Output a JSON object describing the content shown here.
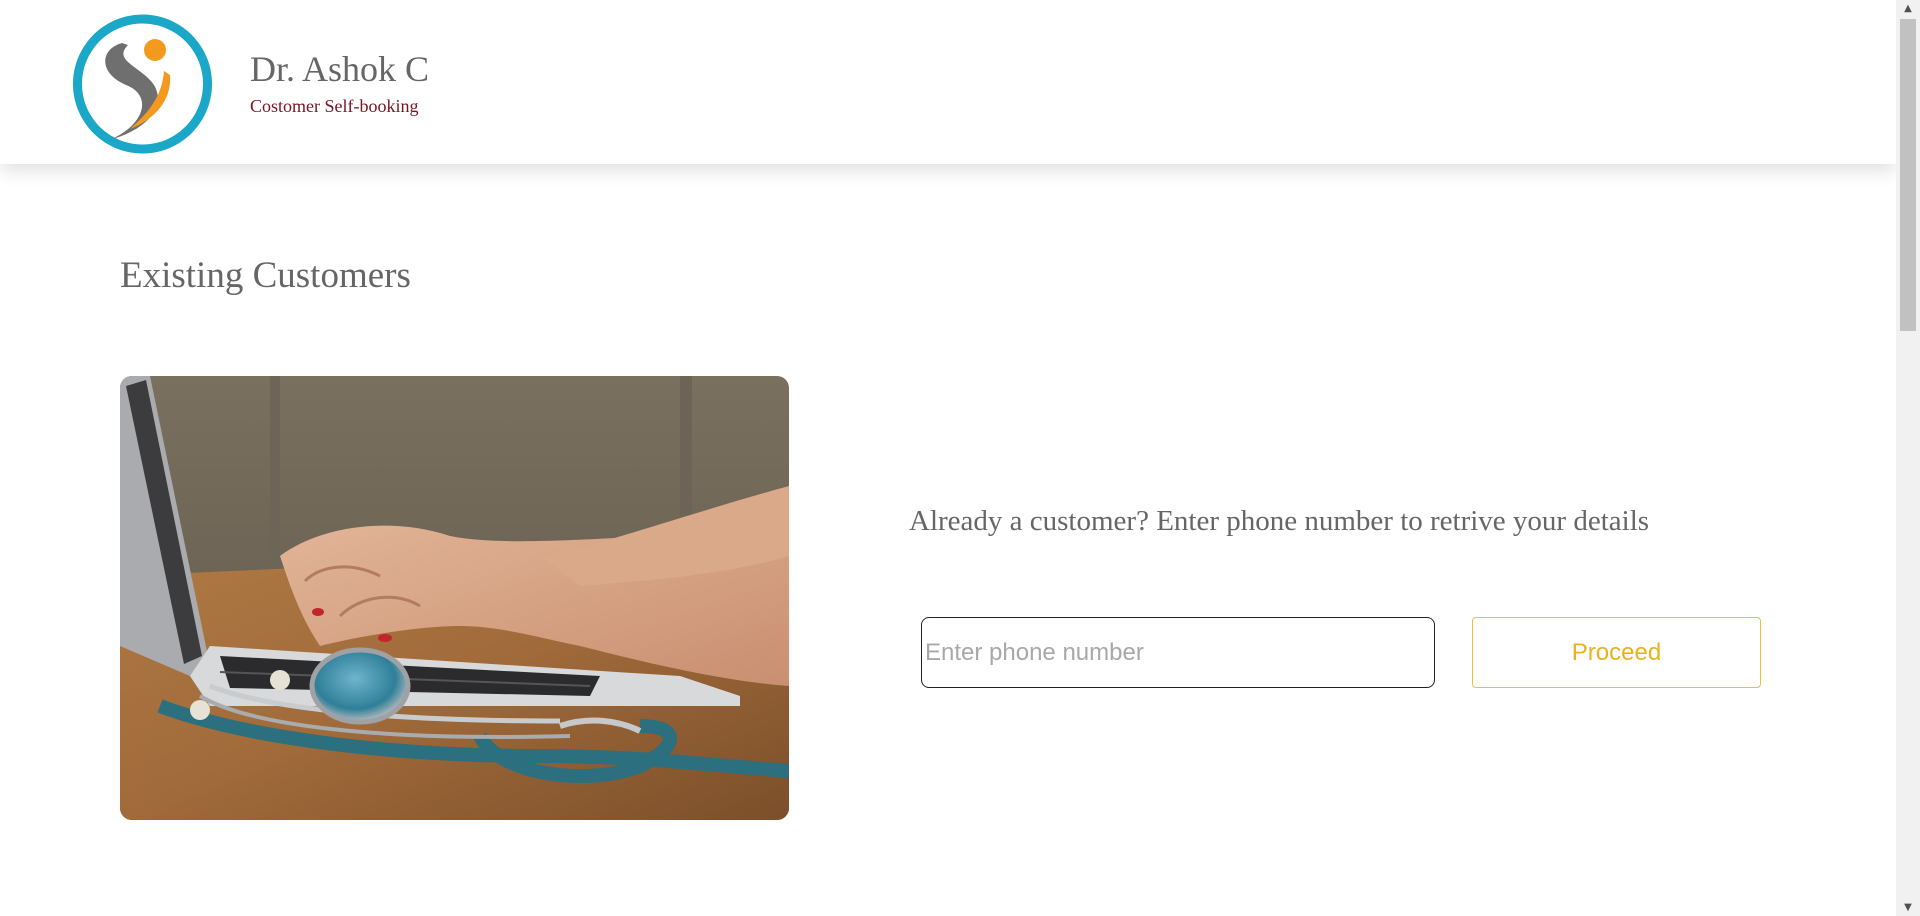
{
  "header": {
    "logo_icon": "person-swoosh-logo-icon",
    "brand_name": "Dr. Ashok C",
    "brand_subtitle": "Costomer Self-booking",
    "colors": {
      "logo_ring": "#1aa7c8",
      "logo_dot": "#f39a1e",
      "logo_figure": "#6f6f70",
      "subtitle": "#7a1222"
    }
  },
  "main": {
    "title": "Existing Customers",
    "hero_image": "laptop-stethoscope-image",
    "prompt": "Already a customer? Enter phone number to retrive your details",
    "phone_input": {
      "placeholder": "Enter phone number",
      "value": ""
    },
    "proceed_label": "Proceed",
    "colors": {
      "accent": "#f2bf2e",
      "text": "#666666"
    }
  },
  "scrollbar": {
    "up_icon": "scroll-up-arrow-icon",
    "down_icon": "scroll-down-arrow-icon"
  }
}
